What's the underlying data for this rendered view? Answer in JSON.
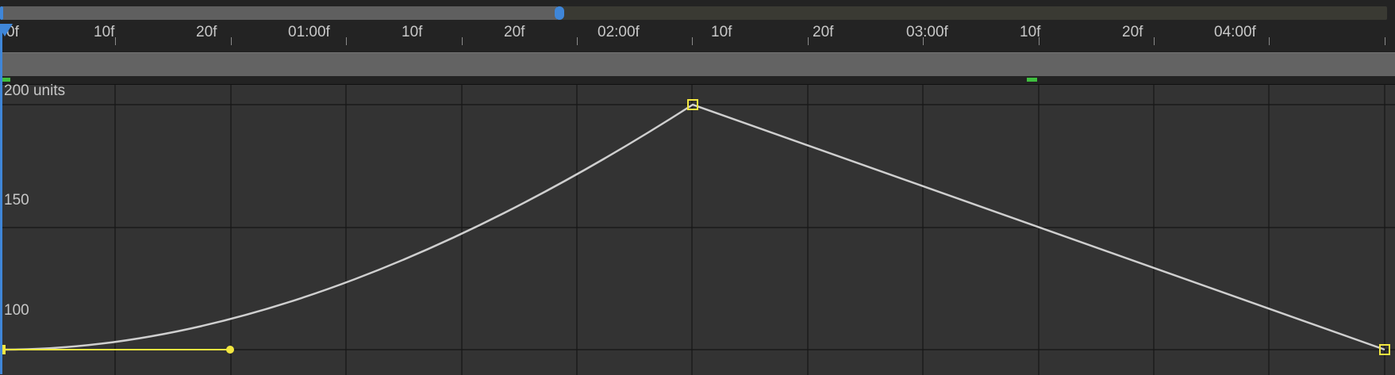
{
  "timeline": {
    "ruler_labels": [
      "0f",
      "10f",
      "20f",
      "01:00f",
      "10f",
      "20f",
      "02:00f",
      "10f",
      "20f",
      "03:00f",
      "10f",
      "20f",
      "04:00f"
    ]
  },
  "graph": {
    "value_labels": {
      "top": "200 units",
      "mid": "150",
      "low": "100"
    },
    "curve_color": "#cfcfcf",
    "keyframe_color": "#f2e640",
    "playhead_color": "#3f86d8",
    "marker_color": "#3fbf3f"
  }
}
